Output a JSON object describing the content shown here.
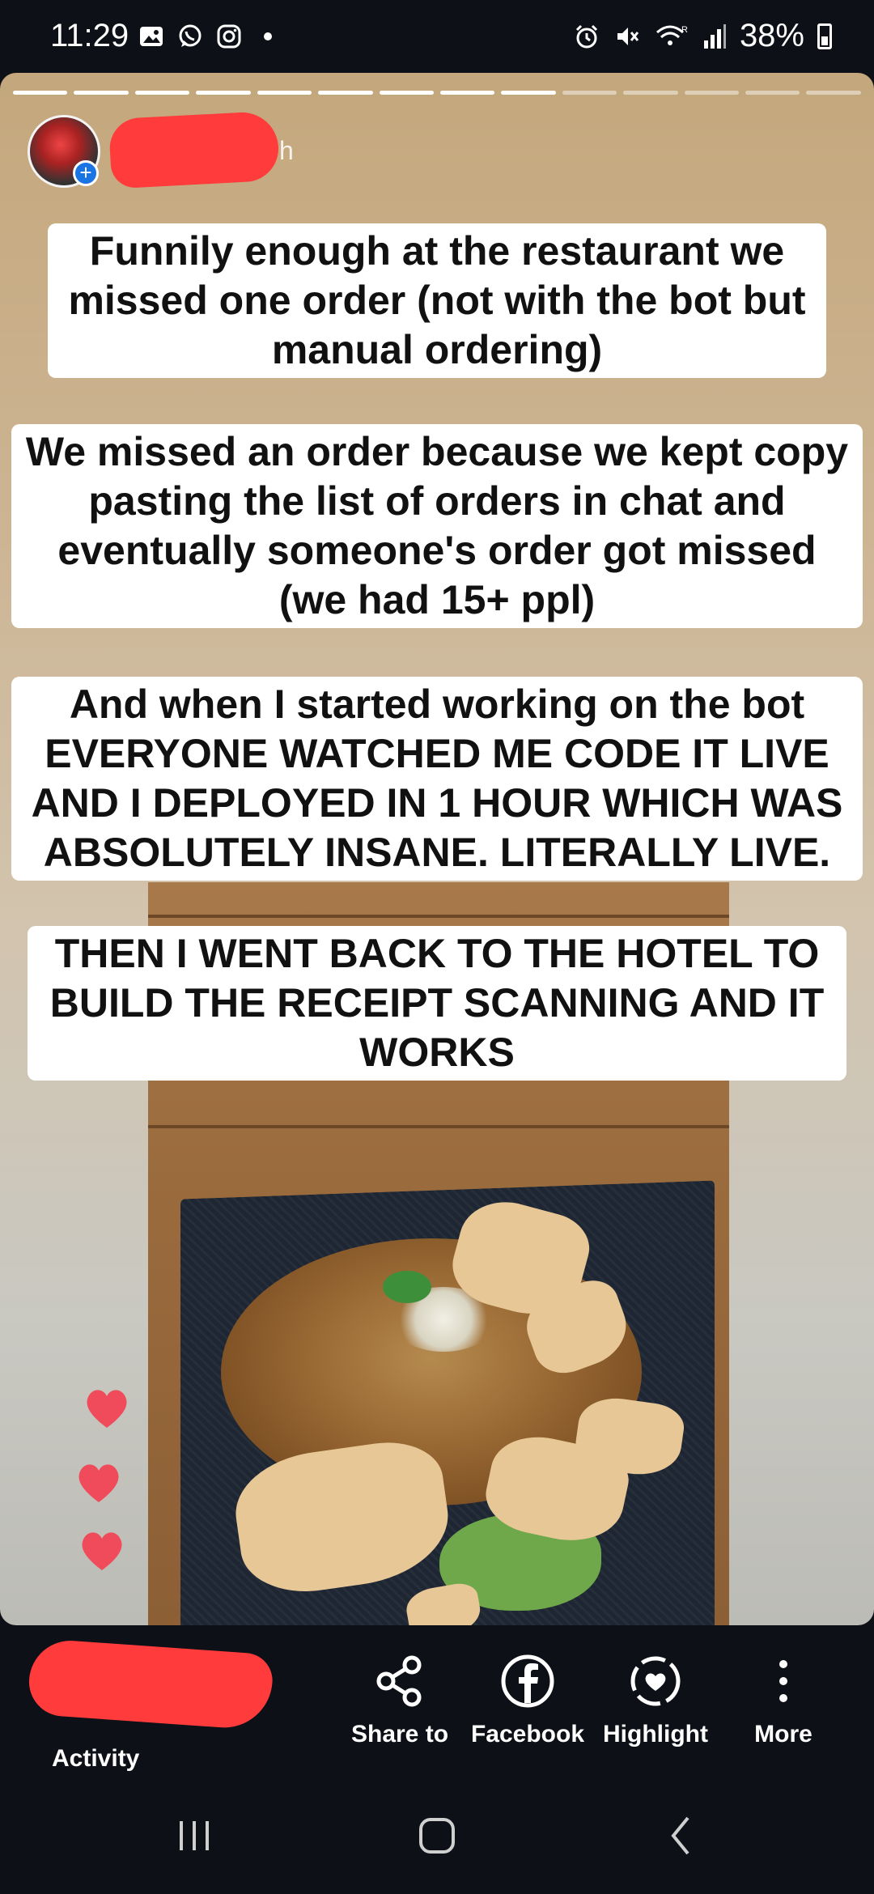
{
  "status_bar": {
    "time": "11:29",
    "battery": "38%",
    "left_icons": [
      "gallery-icon",
      "whatsapp-icon",
      "instagram-icon",
      "dot-icon"
    ],
    "right_icons": [
      "alarm-icon",
      "mute-icon",
      "wifi-icon",
      "signal-icon",
      "battery-icon"
    ]
  },
  "story": {
    "progress": {
      "segments_total": 14,
      "segments_done": 9
    },
    "author_time": "h",
    "captions": [
      "Funnily enough at the restaurant we missed one order (not with the bot but manual ordering)",
      "We missed an order because we kept copy pasting the list of orders in chat and eventually someone's order got missed (we had 15+ ppl)",
      "And when I started working on the bot EVERYONE WATCHED ME CODE IT LIVE AND I DEPLOYED IN 1 HOUR WHICH WAS ABSOLUTELY INSANE. LITERALLY LIVE.",
      "THEN I WENT BACK TO THE HOTEL TO BUILD THE RECEIPT SCANNING AND IT WORKS"
    ],
    "reaction_count": 3
  },
  "actions": {
    "activity": "Activity",
    "share": "Share to",
    "facebook": "Facebook",
    "highlight": "Highlight",
    "more": "More"
  },
  "colors": {
    "background": "#0d1117",
    "heart": "#ef4b5b",
    "redaction": "#ff3b3b",
    "badge": "#1b74e4"
  }
}
